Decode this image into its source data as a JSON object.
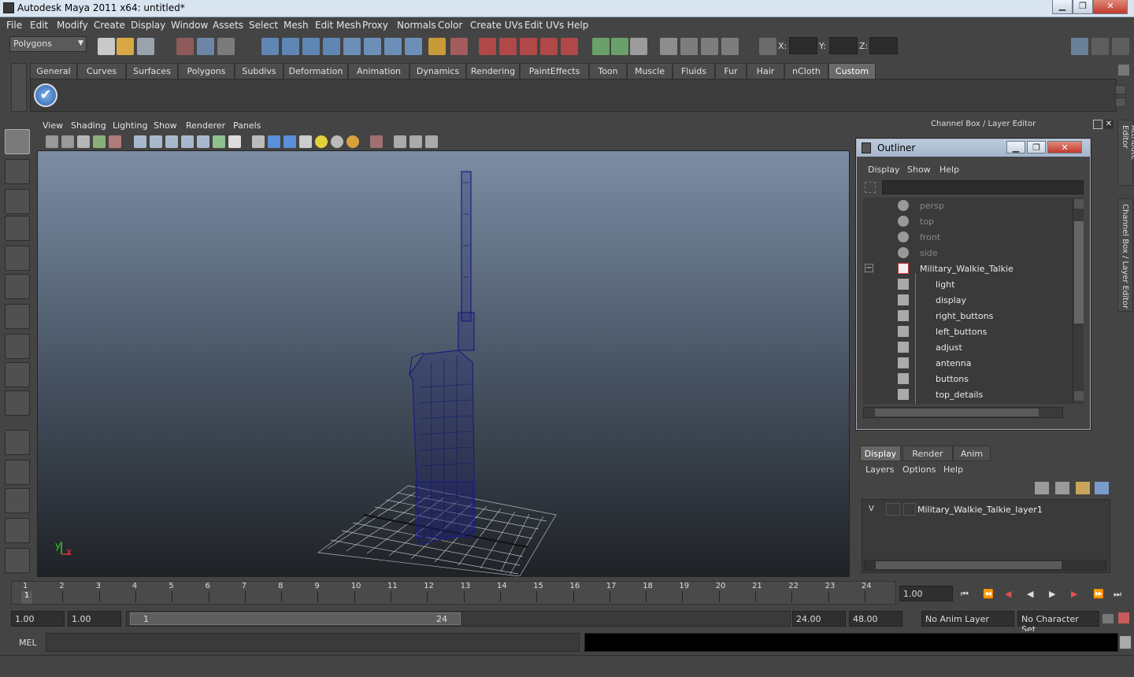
{
  "window": {
    "title": "Autodesk Maya 2011 x64: untitled*",
    "min_label": "▁",
    "max_label": "❐",
    "close_label": "✕"
  },
  "menubar": [
    "File",
    "Edit",
    "Modify",
    "Create",
    "Display",
    "Window",
    "Assets",
    "Select",
    "Mesh",
    "Edit Mesh",
    "Proxy",
    "Normals",
    "Color",
    "Create UVs",
    "Edit UVs",
    "Help"
  ],
  "statusline": {
    "menu_set": "Polygons",
    "x_label": "X:",
    "y_label": "Y:",
    "z_label": "Z:",
    "x_value": "",
    "y_value": "",
    "z_value": ""
  },
  "shelf": {
    "tabs": [
      "General",
      "Curves",
      "Surfaces",
      "Polygons",
      "Subdivs",
      "Deformation",
      "Animation",
      "Dynamics",
      "Rendering",
      "PaintEffects",
      "Toon",
      "Muscle",
      "Fluids",
      "Fur",
      "Hair",
      "nCloth",
      "Custom"
    ],
    "active_tab": "Custom"
  },
  "viewport": {
    "menu": [
      "View",
      "Shading",
      "Lighting",
      "Show",
      "Renderer",
      "Panels"
    ],
    "axis_y": "y",
    "axis_x": "x",
    "model_color": "#1a1f7a",
    "grid_color": "#b8bcc2"
  },
  "channel_box": {
    "title": "Channel Box / Layer Editor",
    "side_tabs": [
      "Attribute Editor",
      "Channel Box / Layer Editor"
    ]
  },
  "outliner": {
    "title": "Outliner",
    "menu": [
      "Display",
      "Show",
      "Help"
    ],
    "search": "",
    "collapse_glyph": "−",
    "rows": [
      {
        "label": "persp",
        "kind": "camera",
        "depth": 0
      },
      {
        "label": "top",
        "kind": "camera",
        "depth": 0
      },
      {
        "label": "front",
        "kind": "camera",
        "depth": 0
      },
      {
        "label": "side",
        "kind": "camera",
        "depth": 0
      },
      {
        "label": "Military_Walkie_Talkie",
        "kind": "group",
        "depth": 0
      },
      {
        "label": "light",
        "kind": "mesh",
        "depth": 1
      },
      {
        "label": "display",
        "kind": "mesh",
        "depth": 1
      },
      {
        "label": "right_buttons",
        "kind": "mesh",
        "depth": 1
      },
      {
        "label": "left_buttons",
        "kind": "mesh",
        "depth": 1
      },
      {
        "label": "adjust",
        "kind": "mesh",
        "depth": 1
      },
      {
        "label": "antenna",
        "kind": "mesh",
        "depth": 1
      },
      {
        "label": "buttons",
        "kind": "mesh",
        "depth": 1
      },
      {
        "label": "top_details",
        "kind": "mesh",
        "depth": 1
      }
    ]
  },
  "layer_editor": {
    "tabs": [
      "Display",
      "Render",
      "Anim"
    ],
    "active_tab": "Display",
    "menu": [
      "Layers",
      "Options",
      "Help"
    ],
    "layers": [
      {
        "visible": "V",
        "name": "Military_Walkie_Talkie_layer1"
      }
    ]
  },
  "timeline": {
    "frames": [
      "1",
      "2",
      "3",
      "4",
      "5",
      "6",
      "7",
      "8",
      "9",
      "10",
      "11",
      "12",
      "13",
      "14",
      "15",
      "16",
      "17",
      "18",
      "19",
      "20",
      "21",
      "22",
      "23",
      "24"
    ],
    "current_frame": "1",
    "current_time": "1.00"
  },
  "range": {
    "start_time": "1.00",
    "playback_start": "1.00",
    "slider_start": "1",
    "slider_end": "24",
    "playback_end": "24.00",
    "end_time": "48.00",
    "anim_layer": "No Anim Layer",
    "character_set": "No Character Set"
  },
  "command": {
    "label": "MEL",
    "input": "",
    "result": ""
  }
}
